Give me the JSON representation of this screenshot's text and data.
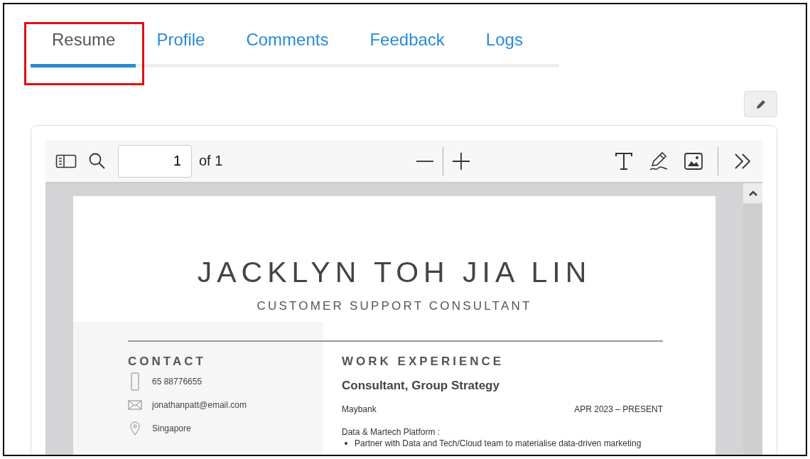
{
  "tabs": [
    {
      "label": "Resume",
      "selected": true,
      "highlighted": true
    },
    {
      "label": "Profile",
      "selected": false,
      "highlighted": false
    },
    {
      "label": "Comments",
      "selected": false,
      "highlighted": false
    },
    {
      "label": "Feedback",
      "selected": false,
      "highlighted": false
    },
    {
      "label": "Logs",
      "selected": false,
      "highlighted": false
    }
  ],
  "viewer_toolbar": {
    "page_number": "1",
    "page_total": "of 1"
  },
  "resume": {
    "name": "JACKLYN TOH JIA LIN",
    "headline": "CUSTOMER SUPPORT CONSULTANT",
    "contact_heading": "CONTACT",
    "contacts": [
      {
        "kind": "phone",
        "text": "65 88776655"
      },
      {
        "kind": "email",
        "text": "jonathanpatt@email.com"
      },
      {
        "kind": "location",
        "text": "Singapore"
      }
    ],
    "work_heading": "WORK EXPERIENCE",
    "job_title": "Consultant, Group Strategy",
    "company": "Maybank",
    "dates": "APR 2023 – PRESENT",
    "section": "Data & Martech Platform :",
    "bullets": [
      "Partner with Data and Tech/Cloud team to materialise data-driven marketing"
    ]
  }
}
